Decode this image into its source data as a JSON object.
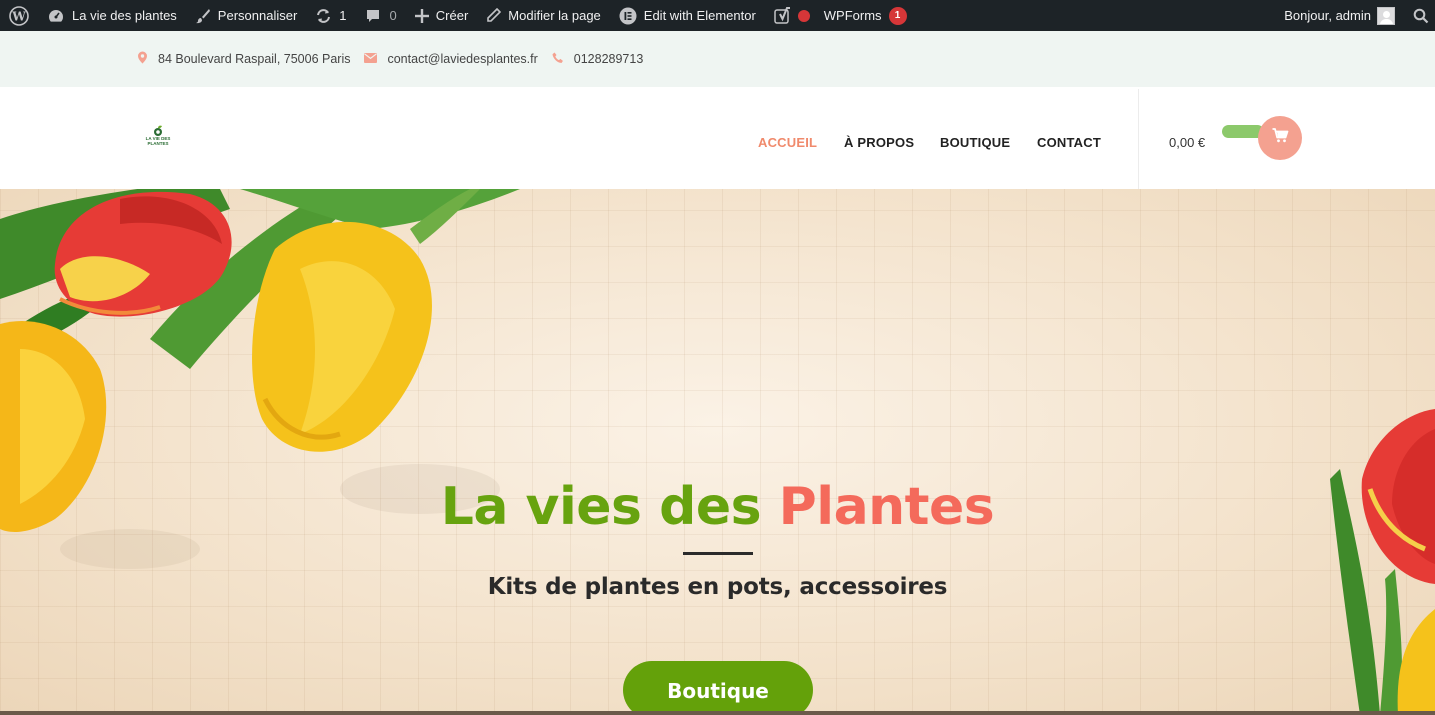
{
  "admin_bar": {
    "site_name": "La vie des plantes",
    "customize": "Personnaliser",
    "updates_count": "1",
    "comments_count": "0",
    "new_label": "Créer",
    "edit_page": "Modifier la page",
    "elementor": "Edit with Elementor",
    "wpforms": "WPForms",
    "wpforms_badge": "1",
    "greeting": "Bonjour, admin"
  },
  "topbar": {
    "address": "84 Boulevard Raspail, 75006 Paris",
    "email": "contact@laviedesplantes.fr",
    "phone": "0128289713"
  },
  "header": {
    "logo_text_1": "LA VIE DES",
    "logo_text_2": "PLANTES",
    "nav": [
      {
        "label": "ACCUEIL",
        "active": true
      },
      {
        "label": "À PROPOS",
        "active": false
      },
      {
        "label": "BOUTIQUE",
        "active": false
      },
      {
        "label": "CONTACT",
        "active": false
      }
    ],
    "cart_total": "0,00 €"
  },
  "hero": {
    "title_part1": "La vies des",
    "title_part2": "Plantes",
    "subtitle": "Kits de plantes en pots, accessoires",
    "button": "Boutique"
  },
  "colors": {
    "admin_bg": "#1d2327",
    "topbar_bg": "#eff5f2",
    "accent_salmon": "#f08a6c",
    "green": "#64a10a",
    "title_red": "#f46a5b"
  }
}
